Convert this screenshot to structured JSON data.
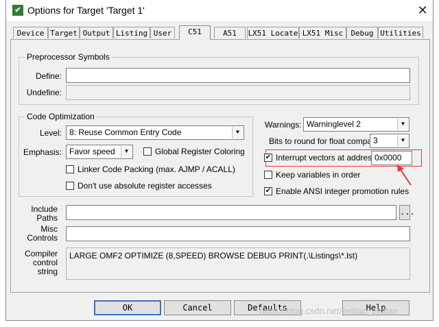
{
  "window": {
    "title": "Options for Target 'Target 1'",
    "icon": "uvision-icon",
    "close_glyph": "✕"
  },
  "tabs": [
    {
      "label": "Device"
    },
    {
      "label": "Target"
    },
    {
      "label": "Output"
    },
    {
      "label": "Listing"
    },
    {
      "label": "User"
    },
    {
      "label": "C51"
    },
    {
      "label": "A51"
    },
    {
      "label": "LX51 Locate"
    },
    {
      "label": "LX51 Misc"
    },
    {
      "label": "Debug"
    },
    {
      "label": "Utilities"
    }
  ],
  "active_tab": "C51",
  "preprocessor": {
    "title": "Preprocessor Symbols",
    "define_label": "Define:",
    "define_value": "",
    "undefine_label": "Undefine:",
    "undefine_value": ""
  },
  "code_optimization": {
    "title": "Code Optimization",
    "level_label": "Level:",
    "level_value": "8: Reuse Common Entry Code",
    "emphasis_label": "Emphasis:",
    "emphasis_value": "Favor speed",
    "global_register_coloring": {
      "label": "Global Register Coloring",
      "checked": false
    },
    "linker_code_packing": {
      "label": "Linker Code Packing (max. AJMP / ACALL)",
      "checked": false
    },
    "no_absolute_register": {
      "label": "Don't use absolute register accesses",
      "checked": false
    }
  },
  "right_options": {
    "warnings_label": "Warnings:",
    "warnings_value": "Warninglevel 2",
    "bits_float_label": "Bits to round for float compare:",
    "bits_float_value": "3",
    "interrupt_vectors": {
      "label": "Interrupt vectors at address:",
      "checked": true,
      "value": "0x0000"
    },
    "keep_variables": {
      "label": "Keep variables in order",
      "checked": false
    },
    "ansi_promotion": {
      "label": "Enable ANSI integer promotion rules",
      "checked": true
    }
  },
  "paths": {
    "include_label_1": "Include",
    "include_label_2": "Paths",
    "include_value": "",
    "browse_label": "...",
    "misc_label_1": "Misc",
    "misc_label_2": "Controls",
    "misc_value": "",
    "compiler_label_1": "Compiler",
    "compiler_label_2": "control",
    "compiler_label_3": "string",
    "compiler_value": "LARGE OMF2 OPTIMIZE (8,SPEED) BROWSE DEBUG PRINT(.\\Listings\\*.lst)"
  },
  "buttons": {
    "ok": "OK",
    "cancel": "Cancel",
    "defaults": "Defaults",
    "help": "Help"
  },
  "watermark": "https://blog.csdn.net/zelitan_zelitan",
  "colors": {
    "highlight_box": "#e23b3b",
    "arrow": "#e23b3b"
  }
}
